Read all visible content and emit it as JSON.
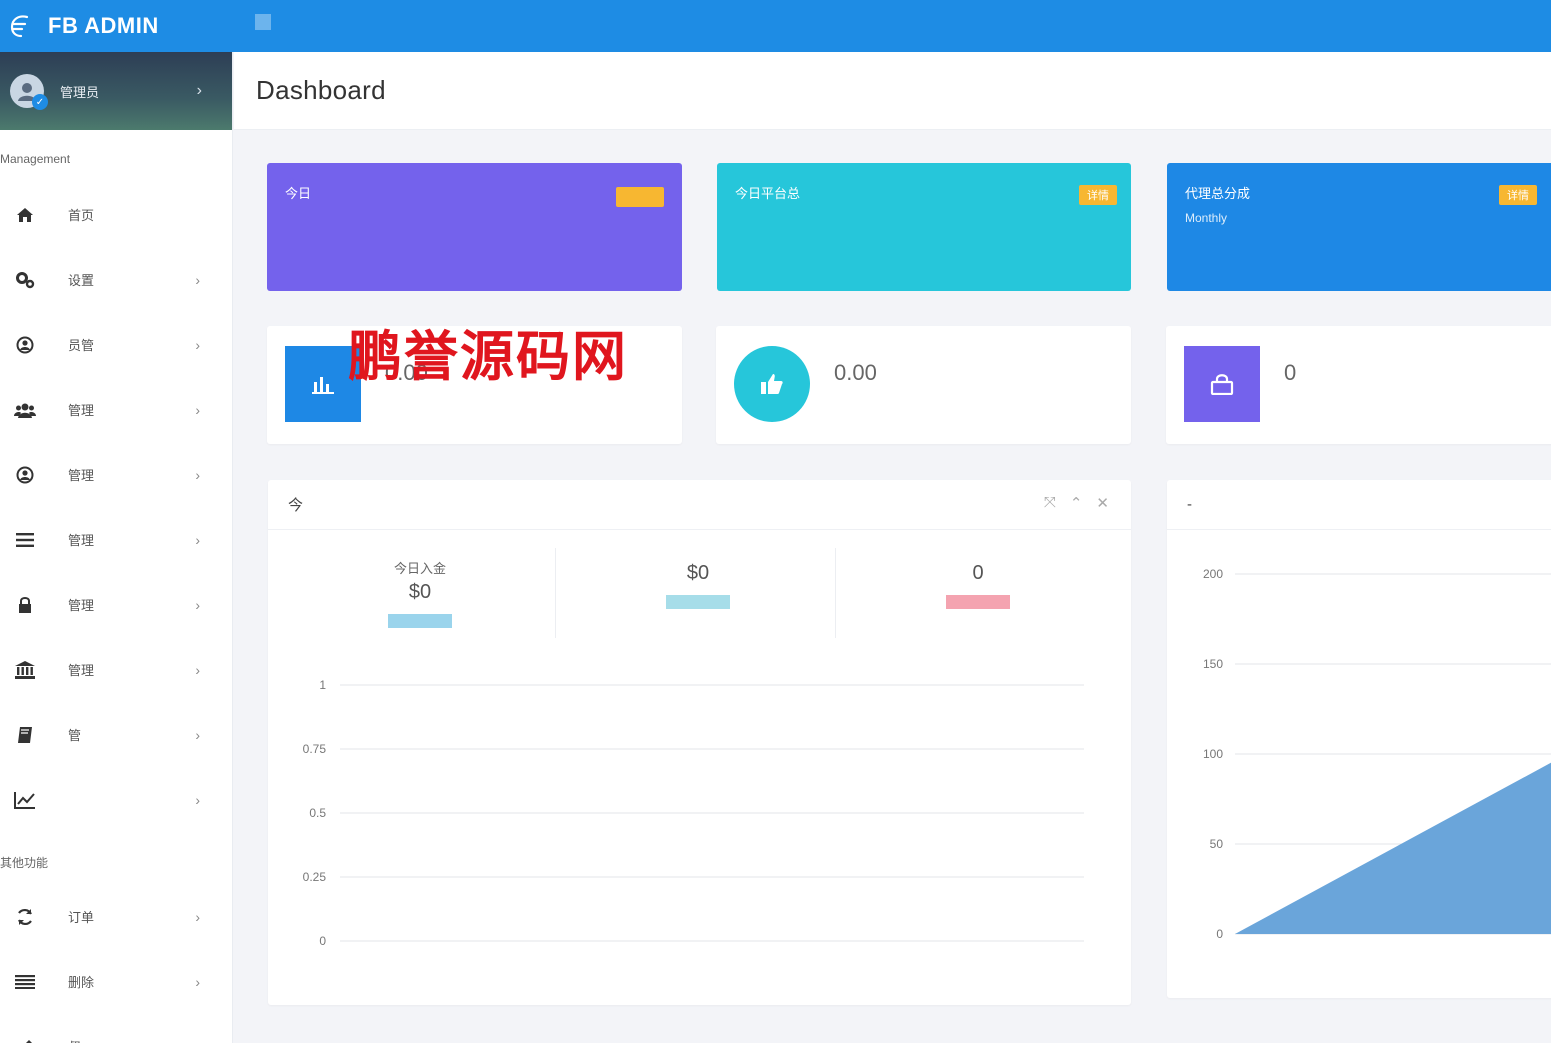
{
  "app": {
    "brand_name": "FB ADMIN",
    "logo_icon": "fb-logo-icon"
  },
  "sidebar": {
    "user_name": "管理员",
    "section_management": "Management",
    "section_other": "其他功能",
    "items": [
      {
        "label": "首页",
        "icon": "home-icon"
      },
      {
        "label": "设置",
        "icon": "gears-icon"
      },
      {
        "label": "员管",
        "icon": "user-circle-icon"
      },
      {
        "label": "管理",
        "icon": "users-icon"
      },
      {
        "label": "管理",
        "icon": "user-circle-icon"
      },
      {
        "label": "管理",
        "icon": "list-icon"
      },
      {
        "label": "管理",
        "icon": "lock-icon"
      },
      {
        "label": "管理",
        "icon": "bank-icon"
      },
      {
        "label": "管",
        "icon": "book-icon"
      },
      {
        "label": "",
        "icon": "line-chart-icon"
      }
    ],
    "other_items": [
      {
        "label": "订单",
        "icon": "refresh-icon"
      },
      {
        "label": "删除",
        "icon": "list-icon"
      },
      {
        "label": "督",
        "icon": "edit-icon"
      }
    ]
  },
  "header": {
    "title": "Dashboard",
    "subtitle": ""
  },
  "stat_cards": [
    {
      "title": "今日",
      "subtitle": "",
      "value": "",
      "badge": "",
      "color": "#7462ec"
    },
    {
      "title": "今日平台总",
      "subtitle": "",
      "value": "",
      "badge": "详情",
      "color": "#26c6da"
    },
    {
      "title": "代理总分成",
      "subtitle": "Monthly",
      "value": "",
      "badge": "详情",
      "color": "#1e88e5"
    }
  ],
  "info_boxes": [
    {
      "value": "0.00",
      "label": "",
      "icon": "bar-chart-icon",
      "color": "#1e88e5"
    },
    {
      "value": "0.00",
      "label": "",
      "icon": "thumbs-up-icon",
      "color": "#26c6da"
    },
    {
      "value": "0",
      "label": "",
      "icon": "shopping-bag-icon",
      "color": "#7462ec"
    }
  ],
  "watermark": "鹏誉源码网",
  "panel_left": {
    "title": "今",
    "kpis": [
      {
        "label": "今日入金",
        "value": "$0",
        "bar_color": "#9ad4ec"
      },
      {
        "label": "",
        "value": "$0",
        "bar_color": "#a6dde9"
      },
      {
        "label": "",
        "value": "0",
        "bar_color": "#f4a3b0"
      }
    ],
    "tools": {
      "expand": "⤧",
      "collapse": "⌃",
      "close": "✕"
    }
  },
  "panel_right": {
    "title": "-"
  },
  "chart_data": [
    {
      "type": "line",
      "title": "",
      "xlabel": "",
      "ylabel": "",
      "ylim": [
        0,
        1
      ],
      "yticks": [
        "1",
        "0.75",
        "0.5",
        "0.25",
        "0"
      ],
      "categories": [
        "",
        "",
        ""
      ],
      "series": [],
      "grid": true
    },
    {
      "type": "area",
      "title": "",
      "xlabel": "",
      "ylabel": "",
      "ylim": [
        0,
        200
      ],
      "yticks": [
        "200",
        "150",
        "100",
        "50",
        "0"
      ],
      "x": [
        0,
        1
      ],
      "series": [
        {
          "values": [
            0,
            100
          ],
          "color": "#6aa5da"
        }
      ],
      "grid": true
    }
  ]
}
